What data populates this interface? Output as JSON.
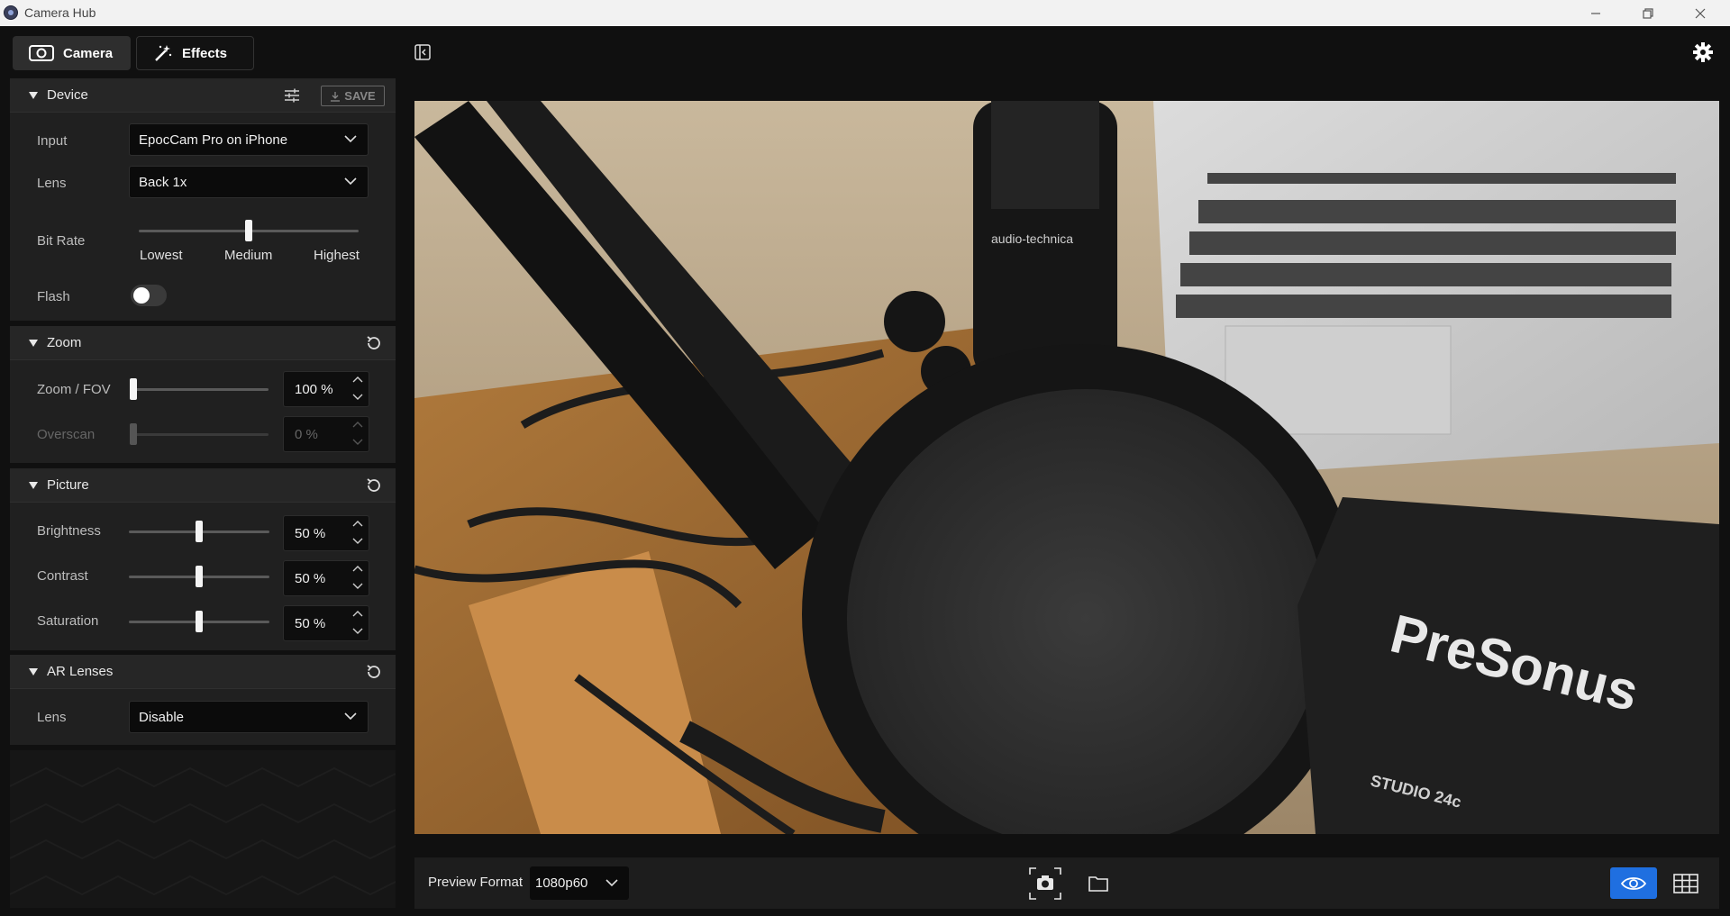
{
  "window": {
    "title": "Camera Hub"
  },
  "tabs": [
    {
      "label": "Camera",
      "icon": "camera-icon"
    },
    {
      "label": "Effects",
      "icon": "magic-wand-icon"
    }
  ],
  "device": {
    "title": "Device",
    "save_label": "SAVE",
    "input_label": "Input",
    "input_value": "EpocCam Pro on iPhone",
    "lens_label": "Lens",
    "lens_value": "Back 1x",
    "bitrate_label": "Bit Rate",
    "bitrate_ticks": [
      "Lowest",
      "Medium",
      "Highest"
    ],
    "bitrate_level": 0.5,
    "flash_label": "Flash",
    "flash_on": false
  },
  "zoom": {
    "title": "Zoom",
    "zoom_label": "Zoom / FOV",
    "zoom_value": "100 %",
    "overscan_label": "Overscan",
    "overscan_value": "0 %"
  },
  "picture": {
    "title": "Picture",
    "brightness_label": "Brightness",
    "brightness_value": "50 %",
    "contrast_label": "Contrast",
    "contrast_value": "50 %",
    "saturation_label": "Saturation",
    "saturation_value": "50 %"
  },
  "ar": {
    "title": "AR Lenses",
    "lens_label": "Lens",
    "lens_value": "Disable"
  },
  "preview": {
    "mic_brand": "audio-technica",
    "interface_brand": "PreSonus",
    "interface_model": "STUDIO 24c"
  },
  "bottom": {
    "preview_format_label": "Preview Format",
    "preview_format_value": "1080p60"
  },
  "colors": {
    "accent": "#1f6fe0",
    "panel": "#202020",
    "header": "#262626"
  }
}
